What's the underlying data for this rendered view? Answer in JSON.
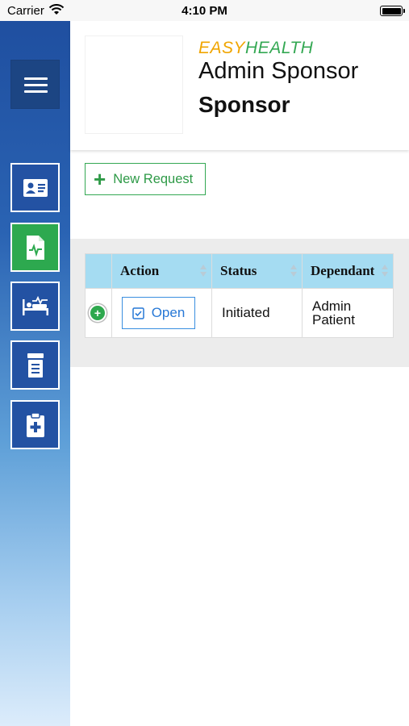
{
  "status_bar": {
    "carrier": "Carrier",
    "time": "4:10 PM"
  },
  "sidebar": {
    "menu_icon": "hamburger-icon",
    "items": [
      {
        "name": "patient-card",
        "icon": "id-card-icon",
        "active": false
      },
      {
        "name": "medical-report",
        "icon": "report-pulse-icon",
        "active": true
      },
      {
        "name": "hospital-bed",
        "icon": "bed-pulse-icon",
        "active": false
      },
      {
        "name": "records",
        "icon": "document-stack-icon",
        "active": false
      },
      {
        "name": "medical-clipboard",
        "icon": "clipboard-medical-icon",
        "active": false
      }
    ]
  },
  "header": {
    "brand_easy": "EASY",
    "brand_health": "HEALTH",
    "user_name": "Admin Sponsor",
    "role": "Sponsor"
  },
  "actions": {
    "new_request": "New Request"
  },
  "table": {
    "columns": [
      "Action",
      "Status",
      "Dependant"
    ],
    "rows": [
      {
        "action": "Open",
        "status": "Initiated",
        "dependant_line1": "Admin",
        "dependant_line2": "Patient"
      }
    ]
  },
  "colors": {
    "sidebar_top": "#1f4fa0",
    "sidebar_bottom": "#dcecfb",
    "active_green": "#2da94f",
    "brand_orange": "#f0a500",
    "brand_green": "#34a853",
    "link_blue": "#2778d6",
    "table_header": "#a5dcf2"
  }
}
